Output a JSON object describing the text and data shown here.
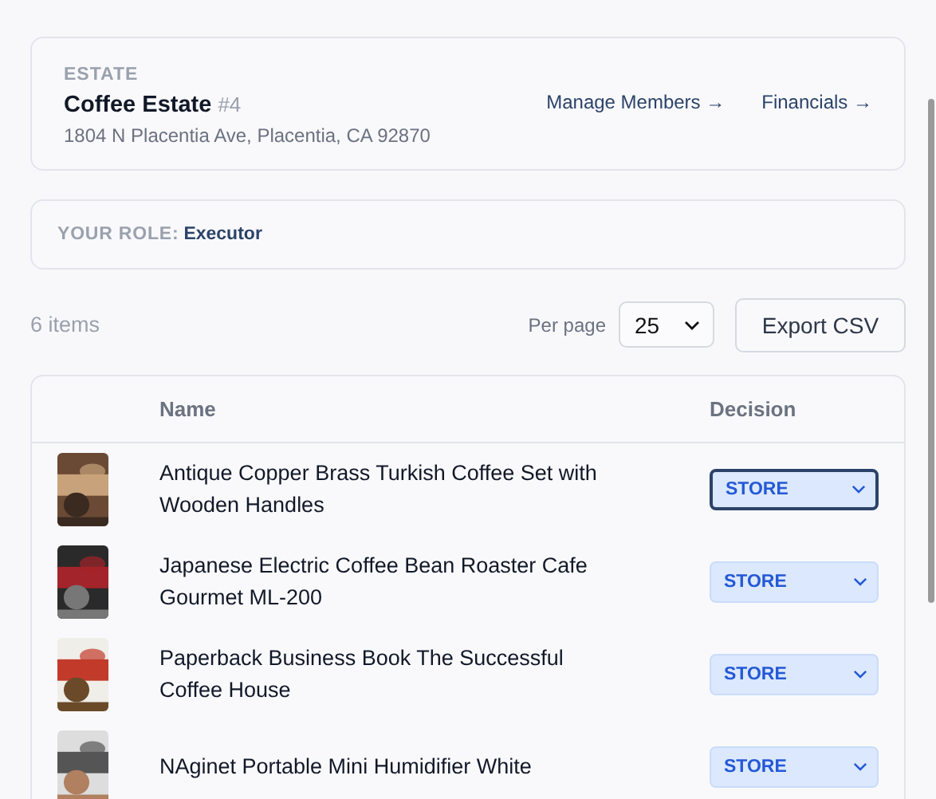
{
  "estate": {
    "label": "ESTATE",
    "name": "Coffee Estate",
    "number": "#4",
    "address": "1804 N Placentia Ave, Placentia, CA 92870",
    "links": [
      "Manage Members →",
      "Financials →"
    ]
  },
  "role": {
    "label": "YOUR ROLE:",
    "value": "Executor"
  },
  "toolbar": {
    "count": "6 items",
    "per_page_label": "Per page",
    "per_page": "25",
    "export": "Export CSV"
  },
  "table": {
    "columns": [
      "Name",
      "Decision"
    ],
    "rows": [
      {
        "name": "Antique Copper Brass Turkish Coffee Set with Wooden Handles",
        "decision": "STORE",
        "focused": true
      },
      {
        "name": "Japanese Electric Coffee Bean Roaster Cafe Gourmet ML-200",
        "decision": "STORE",
        "focused": false
      },
      {
        "name": "Paperback Business Book The Successful Coffee House",
        "decision": "STORE",
        "focused": false
      },
      {
        "name": "NAginet Portable Mini Humidifier White",
        "decision": "STORE",
        "focused": false
      }
    ]
  }
}
